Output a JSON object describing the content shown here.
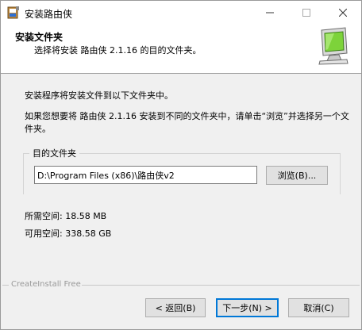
{
  "window": {
    "title": "安装路由侠"
  },
  "header": {
    "title": "安装文件夹",
    "subtitle": "选择将安装 路由侠 2.1.16 的目的文件夹。"
  },
  "content": {
    "intro": "安装程序将安装文件到以下文件夹中。",
    "instructions": "如果您想要将 路由侠 2.1.16 安装到不同的文件夹中，请单击“浏览”并选择另一个文件夹。",
    "group_label": "目的文件夹",
    "path_value": "D:\\Program Files (x86)\\路由侠v2",
    "browse_label": "浏览(B)...",
    "space_required": "所需空间: 18.58 MB",
    "space_available": "可用空间: 338.58 GB"
  },
  "footer": {
    "brand": "CreateInstall Free",
    "back_label": "< 返回(B)",
    "next_label": "下一步(N) >",
    "cancel_label": "取消(C)"
  },
  "colors": {
    "focus_border": "#0078d7",
    "button_bg": "#e1e1e1",
    "monitor_screen": "#7dd33a"
  }
}
